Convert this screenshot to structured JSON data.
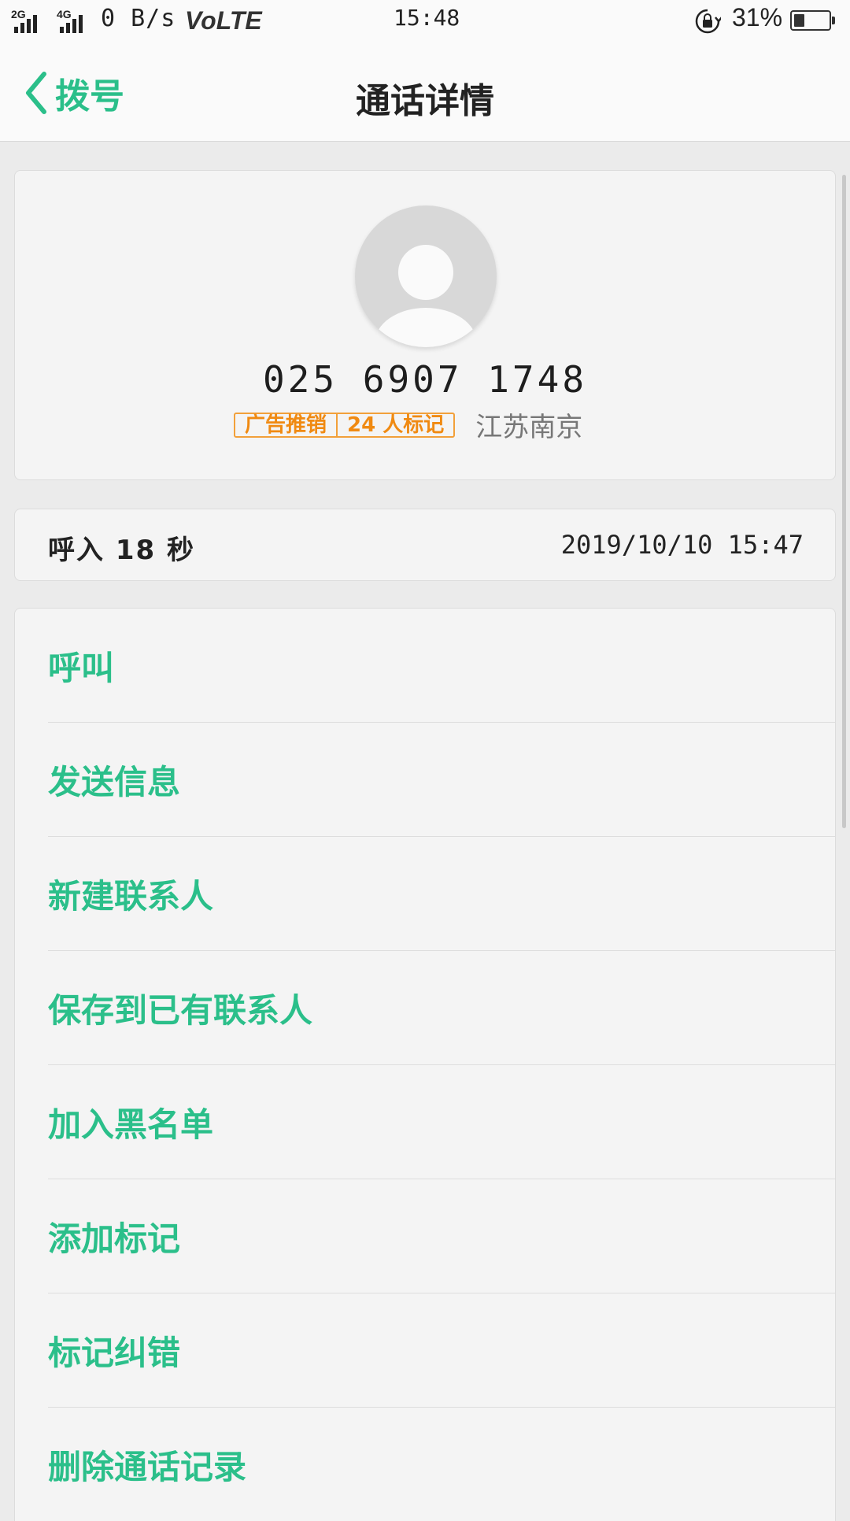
{
  "status_bar": {
    "net1": "2G",
    "net2": "4G",
    "speed": "0 B/s",
    "volte": "VoLTE",
    "time": "15:48",
    "battery_pct": "31%",
    "battery_level": 0.31
  },
  "header": {
    "back_label": "拨号",
    "title": "通话详情"
  },
  "contact": {
    "number": "025 6907 1748",
    "tag_category": "广告推销",
    "tag_count": "24 人标记",
    "location": "江苏南京"
  },
  "call": {
    "type_duration": "呼入  18 秒",
    "datetime": "2019/10/10 15:47"
  },
  "actions": [
    "呼叫",
    "发送信息",
    "新建联系人",
    "保存到已有联系人",
    "加入黑名单",
    "添加标记",
    "标记纠错",
    "删除通话记录"
  ],
  "colors": {
    "accent": "#2bbf8a",
    "tag": "#f08a12",
    "background": "#ebebeb",
    "card": "#f4f4f4"
  }
}
